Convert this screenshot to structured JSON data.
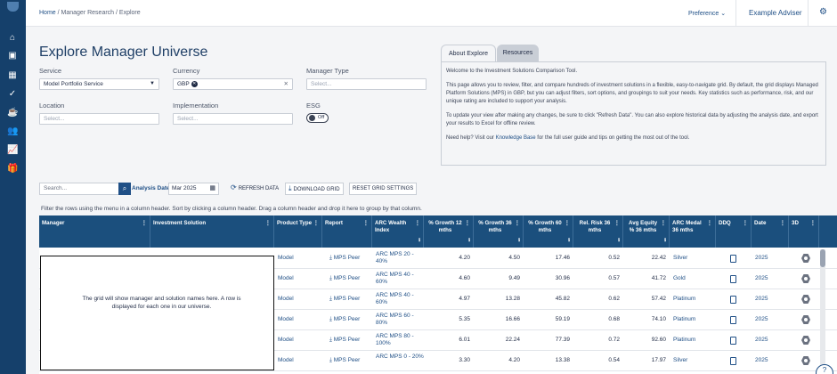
{
  "breadcrumb": {
    "home": "Home",
    "parent": "Manager Research",
    "current": "Explore"
  },
  "topbar": {
    "preference_label": "Preference",
    "preference_icon": "chevron-down-icon",
    "user_label": "Example Adviser",
    "settings_icon": "gear-icon"
  },
  "rail_icons": [
    "home-icon",
    "folder-icon",
    "grid-icon",
    "check-icon",
    "coffee-icon",
    "users-icon",
    "chart-icon",
    "gift-icon"
  ],
  "page_title": "Explore Manager Universe",
  "filters": {
    "service": {
      "label": "Service",
      "value": "Model Portfolio Service"
    },
    "currency": {
      "label": "Currency",
      "chip": "GBP"
    },
    "manager_type": {
      "label": "Manager Type",
      "placeholder": "Select..."
    },
    "location": {
      "label": "Location",
      "placeholder": "Select..."
    },
    "implementation": {
      "label": "Implementation",
      "placeholder": "Select..."
    },
    "esg": {
      "label": "ESG",
      "toggle": "Off"
    }
  },
  "about": {
    "tabs": [
      "About Explore",
      "Resources"
    ],
    "p1": "Welcome to the Investment Solutions Comparison Tool.",
    "p2": "This page allows you to review, filter, and compare hundreds of investment solutions in a flexible, easy-to-navigate grid. By default, the grid displays Managed Platform Solutions (MPS) in GBP, but you can adjust filters, sort options, and groupings to suit your needs. Key statistics such as performance, risk, and our unique rating are included to support your analysis.",
    "p3": "To update your view after making any changes, be sure to click \"Refresh Data\". You can also explore historical data by adjusting the analysis date, and export your results to Excel for offline review.",
    "p4_before": "Need help? Visit our ",
    "p4_link": "Knowledge Base",
    "p4_after": " for the full user guide and tips on getting the most out of the tool."
  },
  "toolbar": {
    "search_placeholder": "Search...",
    "analysis_date_label": "Analysis Date",
    "analysis_date_value": "Mar 2025",
    "refresh_label": "REFRESH DATA",
    "download_label": "DOWNLOAD GRID",
    "reset_label": "RESET GRID SETTINGS"
  },
  "grid_hint": "Filter the rows using the menu in a column header. Sort by clicking a column header. Drag a column header and drop it here to group by that column.",
  "columns": [
    {
      "label": "Manager"
    },
    {
      "label": "Investment Solution"
    },
    {
      "label": "Product Type"
    },
    {
      "label": "Report"
    },
    {
      "label": "ARC Wealth Index"
    },
    {
      "label": "% Growth 12 mths"
    },
    {
      "label": "% Growth 36 mths"
    },
    {
      "label": "% Growth 60 mths"
    },
    {
      "label": "Rel. Risk 36 mths"
    },
    {
      "label": "Avg Equity % 36 mths"
    },
    {
      "label": "ARC Medal 36 mths"
    },
    {
      "label": "DDQ"
    },
    {
      "label": "Date"
    },
    {
      "label": "3D"
    }
  ],
  "overlay_text": "The grid will show manager and solution names here. A row is displayed for each one in our universe.",
  "rows": [
    {
      "product": "Model",
      "report": "MPS Peer",
      "index": "ARC MPS 20 - 40%",
      "g12": "4.20",
      "g36": "4.50",
      "g60": "17.46",
      "risk": "0.52",
      "equity": "22.42",
      "medal": "Silver",
      "date": "2025"
    },
    {
      "product": "Model",
      "report": "MPS Peer",
      "index": "ARC MPS 40 - 60%",
      "g12": "4.60",
      "g36": "9.49",
      "g60": "30.96",
      "risk": "0.57",
      "equity": "41.72",
      "medal": "Gold",
      "date": "2025"
    },
    {
      "product": "Model",
      "report": "MPS Peer",
      "index": "ARC MPS 40 - 60%",
      "g12": "4.97",
      "g36": "13.28",
      "g60": "45.82",
      "risk": "0.62",
      "equity": "57.42",
      "medal": "Platinum",
      "date": "2025"
    },
    {
      "product": "Model",
      "report": "MPS Peer",
      "index": "ARC MPS 60 - 80%",
      "g12": "5.35",
      "g36": "16.66",
      "g60": "59.19",
      "risk": "0.68",
      "equity": "74.10",
      "medal": "Platinum",
      "date": "2025"
    },
    {
      "product": "Model",
      "report": "MPS Peer",
      "index": "ARC MPS 80 - 100%",
      "g12": "6.01",
      "g36": "22.24",
      "g60": "77.39",
      "risk": "0.72",
      "equity": "92.60",
      "medal": "Platinum",
      "date": "2025"
    },
    {
      "product": "Model",
      "report": "MPS Peer",
      "index": "ARC MPS 0 - 20%",
      "g12": "3.30",
      "g36": "4.20",
      "g60": "13.38",
      "risk": "0.54",
      "equity": "17.97",
      "medal": "Silver",
      "date": "2025"
    }
  ],
  "colors": {
    "rail": "#15406b",
    "header": "#1b4f7d",
    "link": "#1f4f86"
  }
}
